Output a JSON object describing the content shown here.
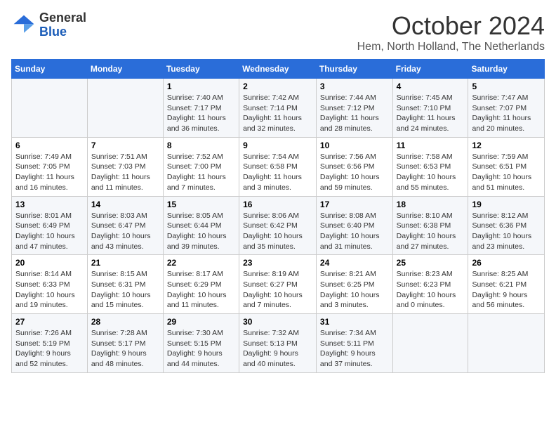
{
  "header": {
    "logo_general": "General",
    "logo_blue": "Blue",
    "month_title": "October 2024",
    "subtitle": "Hem, North Holland, The Netherlands"
  },
  "days_of_week": [
    "Sunday",
    "Monday",
    "Tuesday",
    "Wednesday",
    "Thursday",
    "Friday",
    "Saturday"
  ],
  "weeks": [
    [
      {
        "day": "",
        "info": ""
      },
      {
        "day": "",
        "info": ""
      },
      {
        "day": "1",
        "info": "Sunrise: 7:40 AM\nSunset: 7:17 PM\nDaylight: 11 hours\nand 36 minutes."
      },
      {
        "day": "2",
        "info": "Sunrise: 7:42 AM\nSunset: 7:14 PM\nDaylight: 11 hours\nand 32 minutes."
      },
      {
        "day": "3",
        "info": "Sunrise: 7:44 AM\nSunset: 7:12 PM\nDaylight: 11 hours\nand 28 minutes."
      },
      {
        "day": "4",
        "info": "Sunrise: 7:45 AM\nSunset: 7:10 PM\nDaylight: 11 hours\nand 24 minutes."
      },
      {
        "day": "5",
        "info": "Sunrise: 7:47 AM\nSunset: 7:07 PM\nDaylight: 11 hours\nand 20 minutes."
      }
    ],
    [
      {
        "day": "6",
        "info": "Sunrise: 7:49 AM\nSunset: 7:05 PM\nDaylight: 11 hours\nand 16 minutes."
      },
      {
        "day": "7",
        "info": "Sunrise: 7:51 AM\nSunset: 7:03 PM\nDaylight: 11 hours\nand 11 minutes."
      },
      {
        "day": "8",
        "info": "Sunrise: 7:52 AM\nSunset: 7:00 PM\nDaylight: 11 hours\nand 7 minutes."
      },
      {
        "day": "9",
        "info": "Sunrise: 7:54 AM\nSunset: 6:58 PM\nDaylight: 11 hours\nand 3 minutes."
      },
      {
        "day": "10",
        "info": "Sunrise: 7:56 AM\nSunset: 6:56 PM\nDaylight: 10 hours\nand 59 minutes."
      },
      {
        "day": "11",
        "info": "Sunrise: 7:58 AM\nSunset: 6:53 PM\nDaylight: 10 hours\nand 55 minutes."
      },
      {
        "day": "12",
        "info": "Sunrise: 7:59 AM\nSunset: 6:51 PM\nDaylight: 10 hours\nand 51 minutes."
      }
    ],
    [
      {
        "day": "13",
        "info": "Sunrise: 8:01 AM\nSunset: 6:49 PM\nDaylight: 10 hours\nand 47 minutes."
      },
      {
        "day": "14",
        "info": "Sunrise: 8:03 AM\nSunset: 6:47 PM\nDaylight: 10 hours\nand 43 minutes."
      },
      {
        "day": "15",
        "info": "Sunrise: 8:05 AM\nSunset: 6:44 PM\nDaylight: 10 hours\nand 39 minutes."
      },
      {
        "day": "16",
        "info": "Sunrise: 8:06 AM\nSunset: 6:42 PM\nDaylight: 10 hours\nand 35 minutes."
      },
      {
        "day": "17",
        "info": "Sunrise: 8:08 AM\nSunset: 6:40 PM\nDaylight: 10 hours\nand 31 minutes."
      },
      {
        "day": "18",
        "info": "Sunrise: 8:10 AM\nSunset: 6:38 PM\nDaylight: 10 hours\nand 27 minutes."
      },
      {
        "day": "19",
        "info": "Sunrise: 8:12 AM\nSunset: 6:36 PM\nDaylight: 10 hours\nand 23 minutes."
      }
    ],
    [
      {
        "day": "20",
        "info": "Sunrise: 8:14 AM\nSunset: 6:33 PM\nDaylight: 10 hours\nand 19 minutes."
      },
      {
        "day": "21",
        "info": "Sunrise: 8:15 AM\nSunset: 6:31 PM\nDaylight: 10 hours\nand 15 minutes."
      },
      {
        "day": "22",
        "info": "Sunrise: 8:17 AM\nSunset: 6:29 PM\nDaylight: 10 hours\nand 11 minutes."
      },
      {
        "day": "23",
        "info": "Sunrise: 8:19 AM\nSunset: 6:27 PM\nDaylight: 10 hours\nand 7 minutes."
      },
      {
        "day": "24",
        "info": "Sunrise: 8:21 AM\nSunset: 6:25 PM\nDaylight: 10 hours\nand 3 minutes."
      },
      {
        "day": "25",
        "info": "Sunrise: 8:23 AM\nSunset: 6:23 PM\nDaylight: 10 hours\nand 0 minutes."
      },
      {
        "day": "26",
        "info": "Sunrise: 8:25 AM\nSunset: 6:21 PM\nDaylight: 9 hours\nand 56 minutes."
      }
    ],
    [
      {
        "day": "27",
        "info": "Sunrise: 7:26 AM\nSunset: 5:19 PM\nDaylight: 9 hours\nand 52 minutes."
      },
      {
        "day": "28",
        "info": "Sunrise: 7:28 AM\nSunset: 5:17 PM\nDaylight: 9 hours\nand 48 minutes."
      },
      {
        "day": "29",
        "info": "Sunrise: 7:30 AM\nSunset: 5:15 PM\nDaylight: 9 hours\nand 44 minutes."
      },
      {
        "day": "30",
        "info": "Sunrise: 7:32 AM\nSunset: 5:13 PM\nDaylight: 9 hours\nand 40 minutes."
      },
      {
        "day": "31",
        "info": "Sunrise: 7:34 AM\nSunset: 5:11 PM\nDaylight: 9 hours\nand 37 minutes."
      },
      {
        "day": "",
        "info": ""
      },
      {
        "day": "",
        "info": ""
      }
    ]
  ]
}
